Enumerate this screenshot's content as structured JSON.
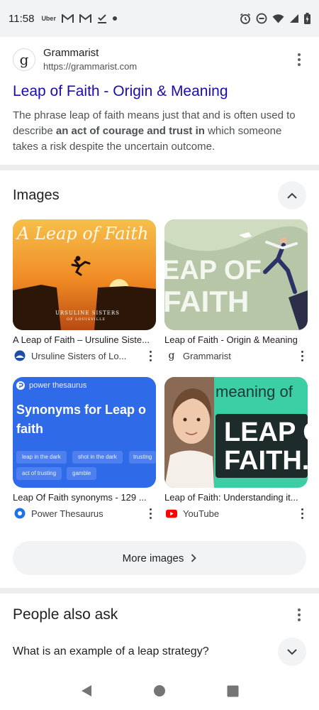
{
  "status_bar": {
    "time": "11:58",
    "left_icons": [
      "uber-icon",
      "gmail-icon",
      "gmail-icon",
      "task-done-icon",
      "dot-icon"
    ],
    "uber_text": "Uber",
    "right_icons": [
      "alarm-icon",
      "do-not-disturb-icon",
      "wifi-icon",
      "signal-icon",
      "battery-icon"
    ]
  },
  "result": {
    "favicon_letter": "g",
    "site_name": "Grammarist",
    "site_url": "https://grammarist.com",
    "title": "Leap of Faith - Origin & Meaning",
    "snippet_before": "The phrase leap of faith means just that and is often used to describe ",
    "snippet_bold": "an act of courage and trust in",
    "snippet_after": " which someone takes a risk despite the uncertain outcome."
  },
  "images": {
    "section_title": "Images",
    "cards": [
      {
        "title": "A Leap of Faith – Ursuline Siste...",
        "source": "Ursuline Sisters of Lo...",
        "source_icon": "ursuline-logo-icon",
        "thumb_text": "A Leap of Faith",
        "thumb_caption": "URSULINE SISTERS",
        "thumb_caption2": "OF LOUISVILLE"
      },
      {
        "title": "Leap of Faith - Origin & Meaning",
        "source": "Grammarist",
        "source_icon": "grammarist-g-icon",
        "source_letter": "g",
        "thumb_line1": "EAP OF",
        "thumb_line2": "FAITH"
      },
      {
        "title": "Leap Of Faith synonyms - 129 ...",
        "source": "Power Thesaurus",
        "source_icon": "power-thesaurus-icon",
        "thumb_brand": "power thesaurus",
        "thumb_heading1": "Synonyms for Leap o",
        "thumb_heading2": "faith",
        "thumb_chips": [
          "leap in the dark",
          "shot in the dark",
          "trusting",
          "act of trusting",
          "gamble"
        ]
      },
      {
        "title": "Leap of Faith: Understanding it...",
        "source": "YouTube",
        "source_icon": "youtube-icon",
        "thumb_small": "meaning of",
        "thumb_big1": "LEAP O",
        "thumb_big2": "FAITH."
      }
    ],
    "more_label": "More images"
  },
  "people_also_ask": {
    "title": "People also ask",
    "question": "What is an example of a leap strategy?"
  },
  "colors": {
    "link": "#1a0dab",
    "text": "#202124",
    "muted": "#4d5156",
    "chip_bg": "#f1f3f4",
    "divider": "#ecedef",
    "youtube_red": "#ff0000",
    "thesaurus_blue": "#1a73e8"
  }
}
